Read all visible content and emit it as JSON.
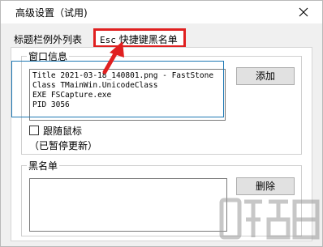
{
  "window": {
    "title": "高级设置（试用)"
  },
  "tabs": [
    {
      "label": "标题栏例外列表"
    },
    {
      "key": "Esc",
      "label": "快捷键黑名单"
    }
  ],
  "window_info": {
    "legend": "窗口信息",
    "lines": [
      "Title 2021-03-18_140801.png - FastStone",
      "Class TMainWin.UnicodeClass",
      "EXE FSCapture.exe",
      "PID 3056"
    ],
    "add_label": "添加",
    "follow_mouse_label": "跟随鼠标",
    "follow_mouse_checked": false,
    "paused_note": "（已暂停更新）"
  },
  "blacklist": {
    "legend": "黑名单",
    "delete_label": "删除",
    "items": []
  },
  "icons": {
    "close": "close-icon",
    "annotation_arrow": "red-arrow-icon",
    "watermark": "site-watermark-logo"
  },
  "colors": {
    "highlight_red": "#e02020",
    "focus_blue": "#1e78b4"
  }
}
